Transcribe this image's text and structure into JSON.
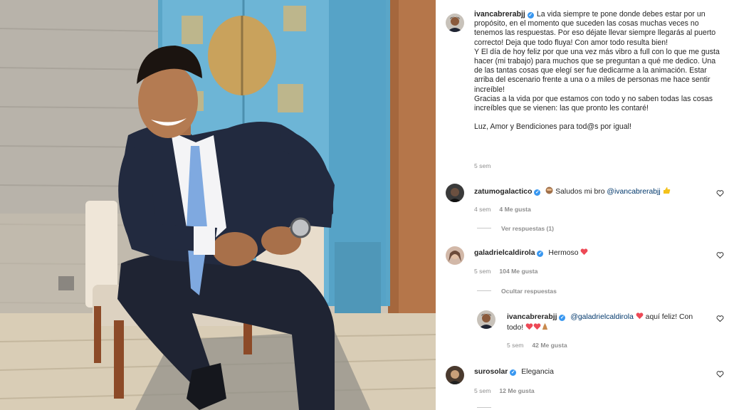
{
  "colors": {
    "verified": "#3897f0",
    "heart": "#ed4956",
    "link": "#00376b",
    "meta": "#8e8e8e"
  },
  "caption": {
    "username": "ivancabrerabjj",
    "paragraph1": "La vida siempre te pone donde debes estar por un propósito, en el momento que suceden las cosas muchas veces no tenemos las respuestas. Por eso déjate llevar siempre llegarás al puerto correcto! Deja que todo fluya! Con amor todo resulta bien!",
    "paragraph2": "Y El día de hoy feliz por que una vez más vibro a full con lo que me gusta hacer (mi trabajo) para muchos que se preguntan a qué me dedico. Una de las tantas cosas que elegí ser fue dedicarme a la animación. Estar arriba del escenario frente a una o a miles de personas me hace sentir increíble!",
    "paragraph3": "Gracias a la vida por que estamos con todo y no saben todas las cosas increíbles que se vienen: las que pronto les contaré!",
    "paragraph4": "Luz, Amor y Bendiciones para tod@s por igual!",
    "time": "5 sem"
  },
  "comments": [
    {
      "username": "zatumogalactico",
      "text": "Saludos mi bro",
      "mention": "@ivancabrerabjj",
      "time": "4 sem",
      "likes": "4 Me gusta",
      "replies_toggle": "Ver respuestas (1)",
      "icon_before": "see-no-evil-monkey-icon",
      "icon_after": "thumbs-up-icon"
    },
    {
      "username": "galadrielcaldirola",
      "text": "Hermoso",
      "time": "5 sem",
      "likes": "104 Me gusta",
      "replies_toggle": "Ocultar respuestas",
      "icon_after": "red-heart-icon"
    },
    {
      "username": "ivancabrerabjj",
      "mention": "@galadrielcaldirola",
      "text": "aquí feliz! Con todo!",
      "time": "5 sem",
      "likes": "42 Me gusta",
      "icons": [
        "red-heart-icon",
        "red-heart-icon",
        "red-heart-icon",
        "praying-hands-icon"
      ]
    },
    {
      "username": "surosolar",
      "text": "Elegancia",
      "time": "5 sem",
      "likes": "12 Me gusta"
    }
  ]
}
